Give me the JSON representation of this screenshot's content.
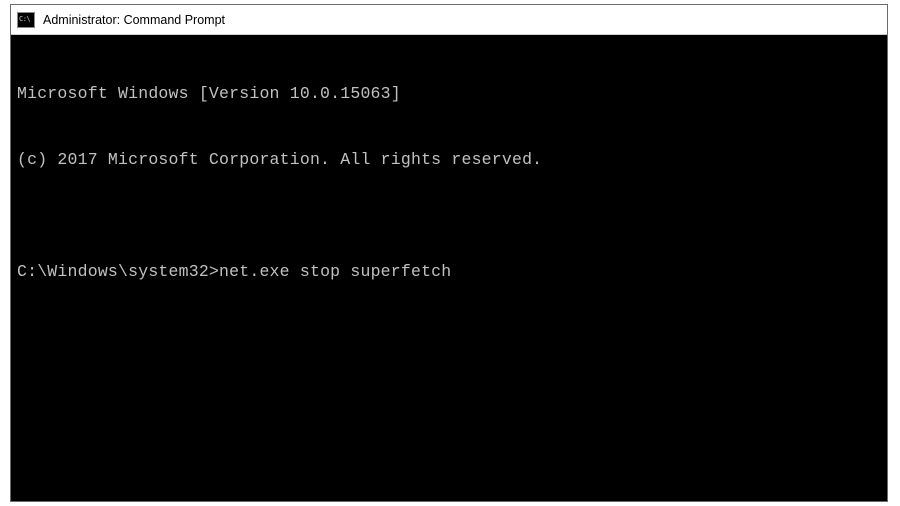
{
  "titlebar": {
    "icon_label": "C:\\",
    "title": "Administrator: Command Prompt"
  },
  "terminal": {
    "line1": "Microsoft Windows [Version 10.0.15063]",
    "line2": "(c) 2017 Microsoft Corporation. All rights reserved.",
    "blank": "",
    "prompt": "C:\\Windows\\system32>",
    "command": "net.exe stop superfetch"
  }
}
